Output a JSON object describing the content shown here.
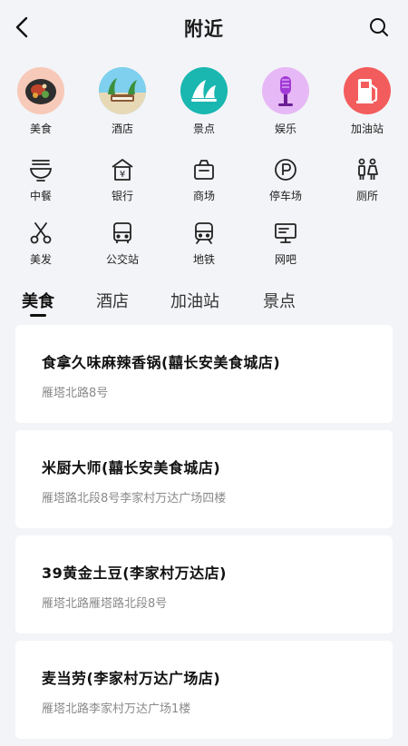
{
  "header": {
    "title": "附近",
    "back_icon": "chevron-left-icon",
    "search_icon": "search-icon"
  },
  "categories_top": [
    {
      "label": "美食",
      "icon": "food-icon",
      "color": "#f7c9b8"
    },
    {
      "label": "酒店",
      "icon": "hotel-icon",
      "color": "#6ac9e6"
    },
    {
      "label": "景点",
      "icon": "attraction-icon",
      "color": "#19b7b0"
    },
    {
      "label": "娱乐",
      "icon": "entertainment-icon",
      "color": "#d57bf0"
    },
    {
      "label": "加油站",
      "icon": "gas-station-icon",
      "color": "#f35c5c"
    }
  ],
  "categories_grid": [
    {
      "label": "中餐",
      "icon": "noodle-bowl-icon"
    },
    {
      "label": "银行",
      "icon": "bank-icon"
    },
    {
      "label": "商场",
      "icon": "shopping-basket-icon"
    },
    {
      "label": "停车场",
      "icon": "parking-icon"
    },
    {
      "label": "厕所",
      "icon": "restroom-icon"
    },
    {
      "label": "美发",
      "icon": "scissors-icon"
    },
    {
      "label": "公交站",
      "icon": "bus-icon"
    },
    {
      "label": "地铁",
      "icon": "subway-icon"
    },
    {
      "label": "网吧",
      "icon": "computer-icon"
    }
  ],
  "tabs": [
    {
      "label": "美食",
      "active": true
    },
    {
      "label": "酒店",
      "active": false
    },
    {
      "label": "加油站",
      "active": false
    },
    {
      "label": "景点",
      "active": false
    }
  ],
  "places": [
    {
      "name": "食拿久味麻辣香锅(囍长安美食城店)",
      "address": "雁塔北路8号"
    },
    {
      "name": "米厨大师(囍长安美食城店)",
      "address": "雁塔路北段8号李家村万达广场四楼"
    },
    {
      "name": "39黄金土豆(李家村万达店)",
      "address": "雁塔北路雁塔路北段8号"
    },
    {
      "name": "麦当劳(李家村万达广场店)",
      "address": "雁塔北路李家村万达广场1楼"
    }
  ]
}
